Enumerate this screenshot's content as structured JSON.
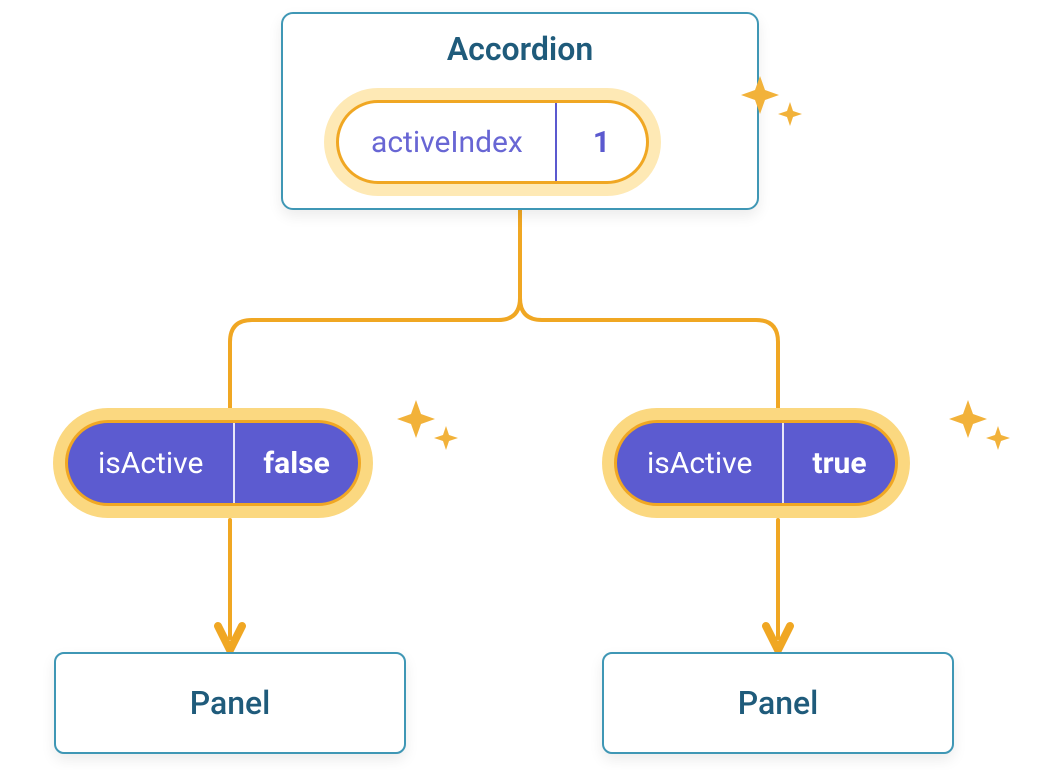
{
  "accordion": {
    "title": "Accordion",
    "state": {
      "key": "activeIndex",
      "value": "1"
    }
  },
  "children": [
    {
      "prop": {
        "key": "isActive",
        "value": "false"
      },
      "panel_label": "Panel"
    },
    {
      "prop": {
        "key": "isActive",
        "value": "true"
      },
      "panel_label": "Panel"
    }
  ],
  "colors": {
    "card_border": "#3F97B5",
    "title_text": "#1F5B7B",
    "connector": "#F0A723",
    "pill_border": "#F0A723",
    "pill_halo": "#FEEFC3",
    "pill_purple_bg": "#5C5BD0",
    "state_text": "#6866D4"
  }
}
